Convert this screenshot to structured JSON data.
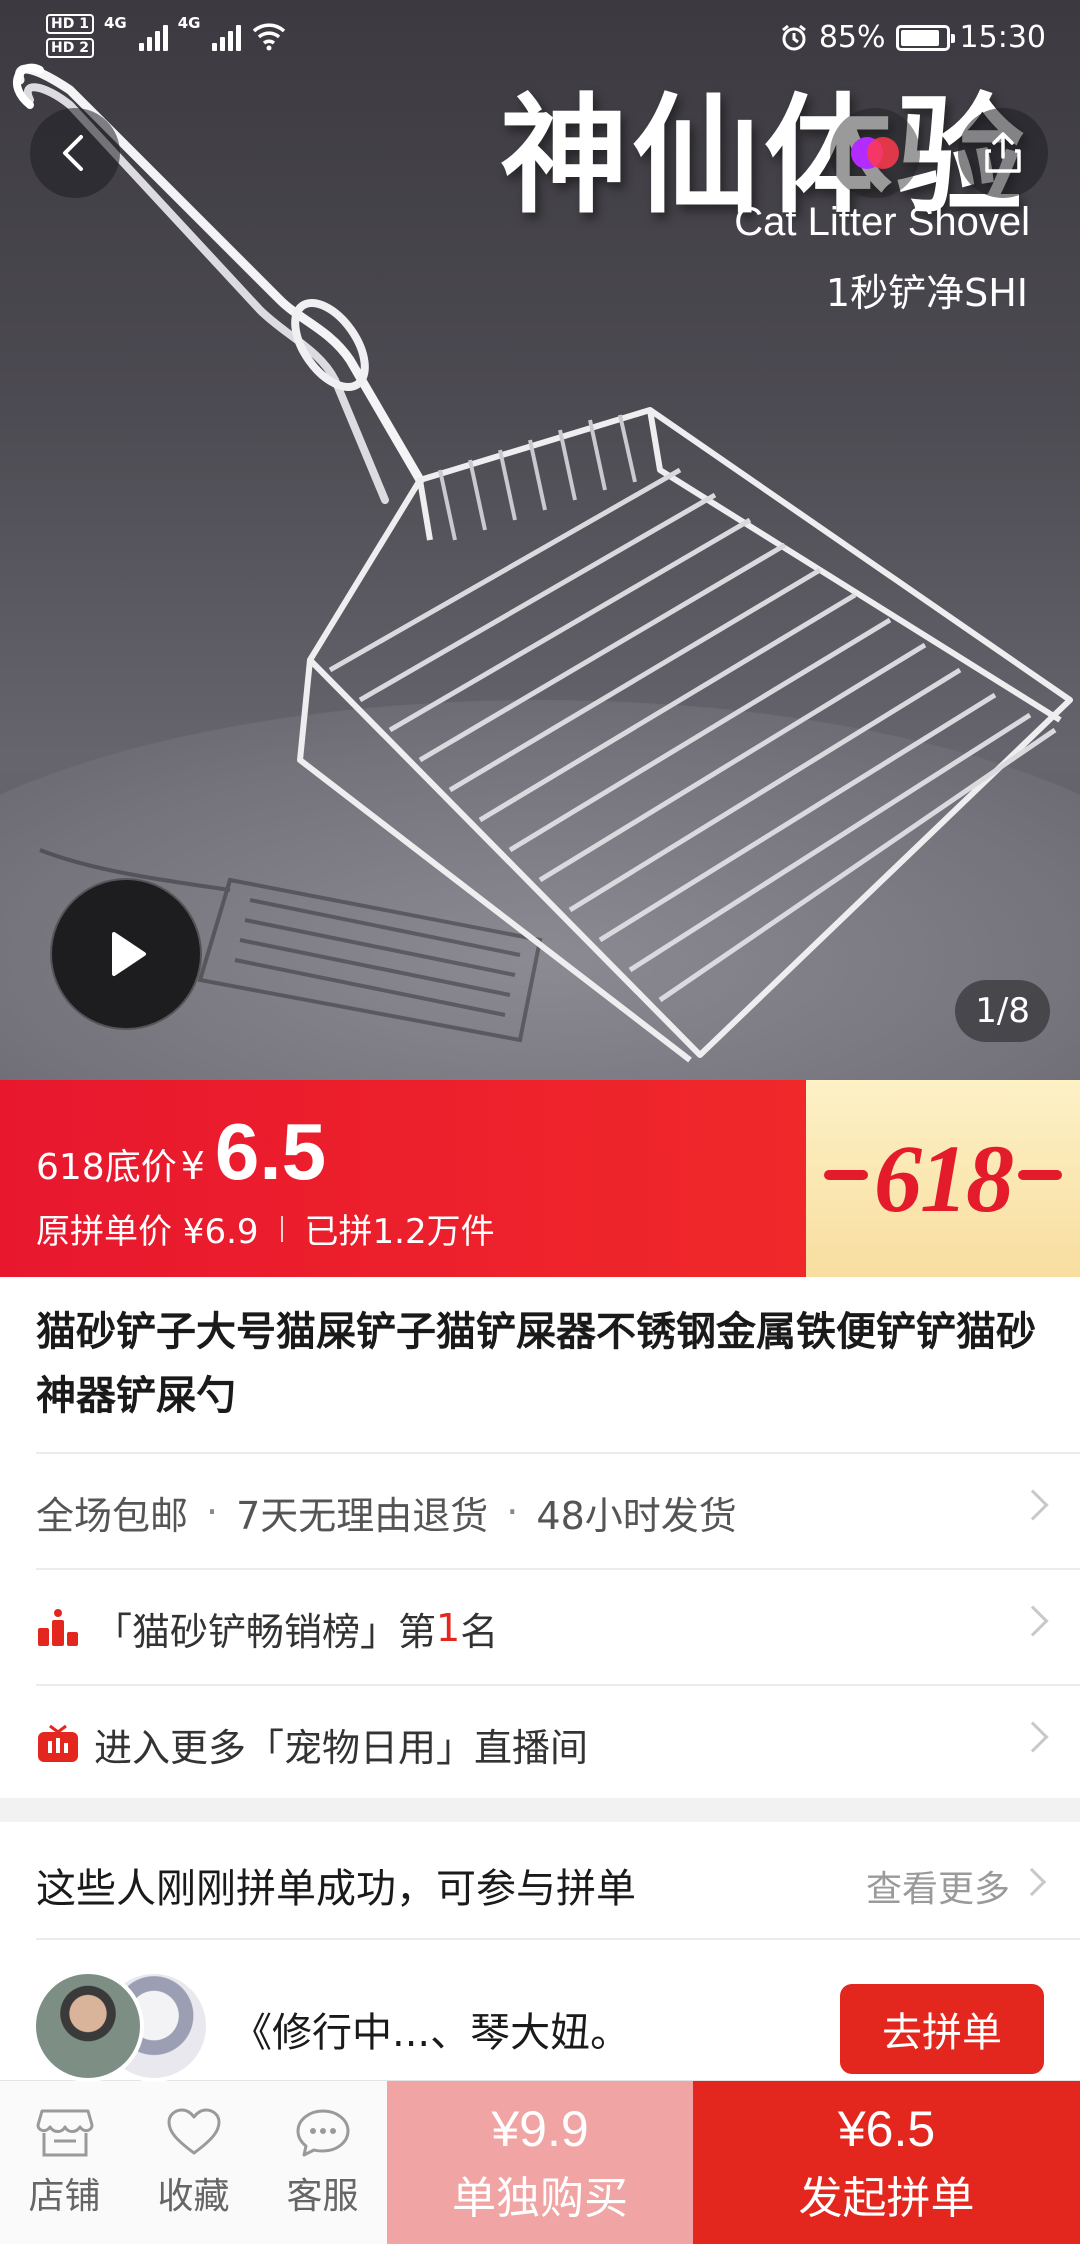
{
  "status_bar": {
    "hd1": "HD 1",
    "hd2": "HD 2",
    "net1": "4G",
    "net2": "4G",
    "battery": "85%",
    "time": "15:30"
  },
  "hero": {
    "headline": "神仙体验",
    "sub_en": "Cat Litter Shovel",
    "sub_cn": "1秒铲净SHI",
    "image_counter": "1/8"
  },
  "price": {
    "label": "618底价",
    "currency": "¥",
    "value": "6.5",
    "original": "原拼单价 ¥6.9",
    "sold": "已拼1.2万件",
    "badge": "618",
    "accent": "#e3261e"
  },
  "product": {
    "title": "猫砂铲子大号猫屎铲子猫铲屎器不锈钢金属铁便铲铲猫砂神器铲屎勺"
  },
  "services": {
    "items": [
      "全场包邮",
      "7天无理由退货",
      "48小时发货"
    ],
    "dot": "·"
  },
  "rank": {
    "prefix": "「猫砂铲畅销榜」第",
    "number": "1",
    "suffix": "名"
  },
  "live": {
    "text": "进入更多「宠物日用」直播间"
  },
  "group": {
    "title": "这些人刚刚拼单成功，可参与拼单",
    "more": "查看更多",
    "name": "《修行中...、琴大妞。",
    "join_label": "去拼单"
  },
  "bottom_bar": {
    "store": "店铺",
    "favorite": "收藏",
    "service": "客服",
    "alone_price": "¥9.9",
    "alone_label": "单独购买",
    "group_price": "¥6.5",
    "group_label": "发起拼单"
  },
  "icons": {
    "back": "chevron-left-icon",
    "share": "share-icon",
    "play": "play-icon",
    "store": "store-icon",
    "favorite": "heart-icon",
    "service": "chat-icon"
  }
}
